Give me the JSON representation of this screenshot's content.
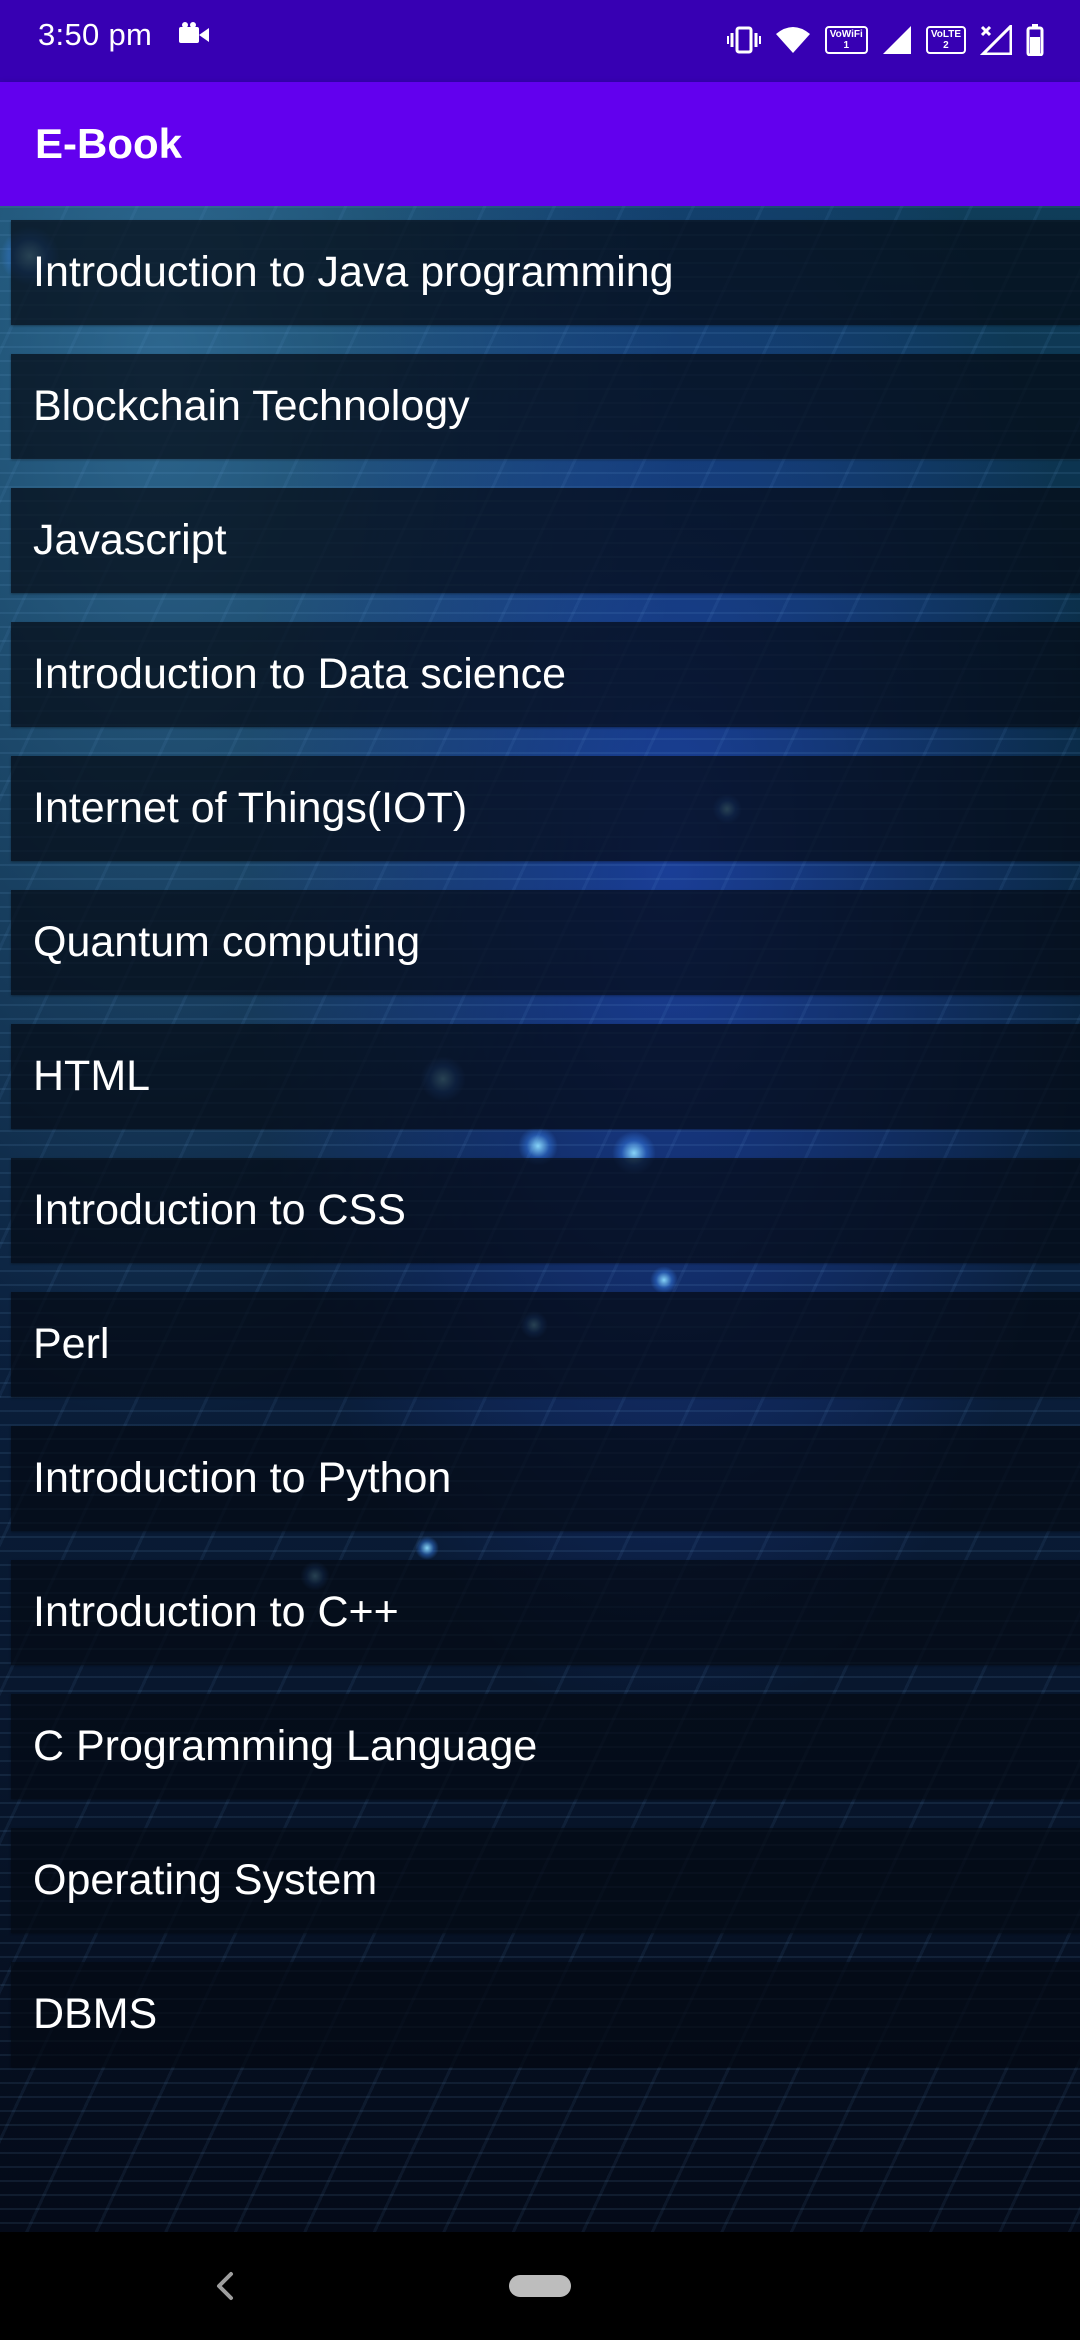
{
  "status_bar": {
    "time": "3:50 pm",
    "icons": [
      "video-camera-icon",
      "vibrate-icon",
      "wifi-icon",
      "vowifi-badge",
      "signal-icon",
      "volte-badge",
      "signal-no-data-icon",
      "battery-icon"
    ],
    "vowifi_label": "VoWiFi",
    "vowifi_sim": "1",
    "volte_label": "VoLTE",
    "volte_sim": "2"
  },
  "app_bar": {
    "title": "E-Book",
    "color": "#6200ee",
    "status_color": "#3700b3"
  },
  "books": [
    "Introduction to Java programming",
    "Blockchain Technology",
    "Javascript",
    "Introduction to Data science",
    "Internet of Things(IOT)",
    "Quantum computing",
    "HTML",
    "Introduction to CSS",
    "Perl",
    "Introduction to Python",
    "Introduction to C++",
    "C Programming Language",
    "Operating System",
    "DBMS"
  ],
  "nav_bar": {
    "icons": [
      "back-chevron-icon",
      "home-pill-icon"
    ]
  }
}
